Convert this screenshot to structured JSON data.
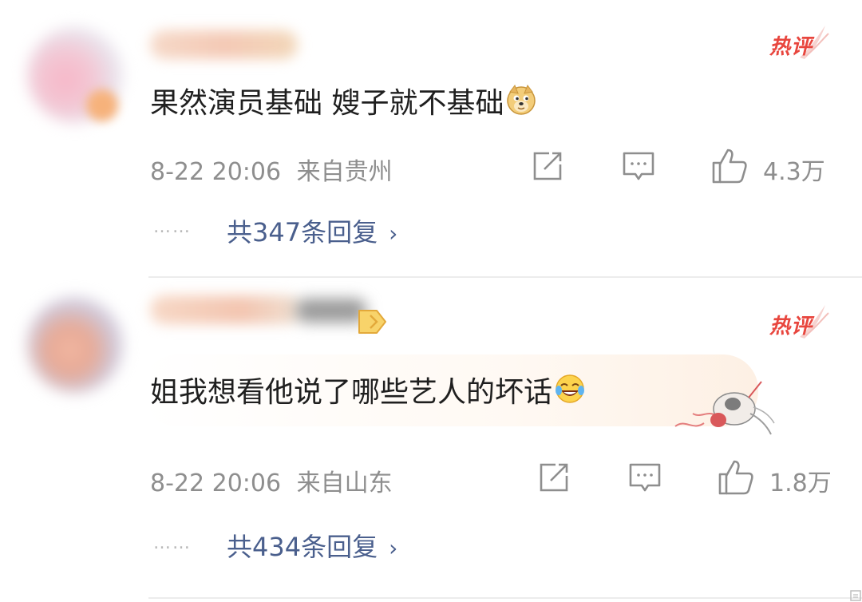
{
  "comments": [
    {
      "hot_label": "热评",
      "text": "果然演员基础 嫂子就不基础",
      "emoji": "doge-emoji",
      "time": "8-22 20:06",
      "location": "来自贵州",
      "likes": "4.3万",
      "replies": "共347条回复"
    },
    {
      "hot_label": "热评",
      "text": "姐我想看他说了哪些艺人的坏话",
      "emoji": "laugh-tears-emoji",
      "time": "8-22 20:06",
      "location": "来自山东",
      "likes": "1.8万",
      "replies": "共434条回复"
    }
  ],
  "dots": "……",
  "icons": {
    "share": "share-icon",
    "comment": "comment-icon",
    "like": "thumbs-up-icon",
    "chevron": "chevron-right-icon"
  },
  "colors": {
    "hot": "#e8463e",
    "link": "#4a5f8d",
    "meta": "#8e8e8e",
    "text": "#1f1f1f"
  }
}
